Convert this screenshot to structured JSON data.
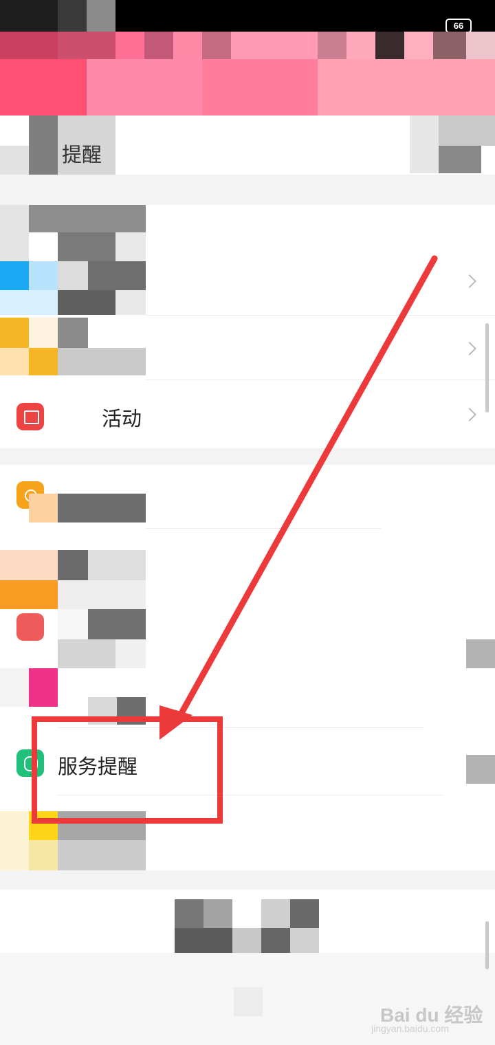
{
  "status_bar": {
    "battery": "66"
  },
  "menu": {
    "reminder_partial": "提醒",
    "activity_partial": "活动",
    "service_reminder": "服务提醒"
  },
  "watermark": {
    "brand": "Bai du 经验",
    "url": "jingyan.baidu.com"
  },
  "colors": {
    "annotation_red": "#ec3a3a",
    "service_icon_green": "#21c07a"
  }
}
